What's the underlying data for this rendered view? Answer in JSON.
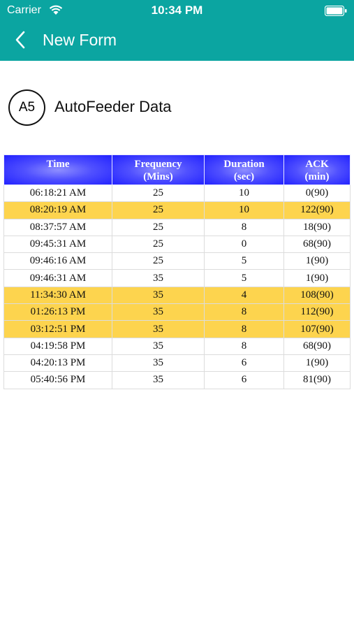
{
  "status": {
    "carrier": "Carrier",
    "time": "10:34 PM"
  },
  "nav": {
    "title": "New Form"
  },
  "section": {
    "badge": "A5",
    "title": "AutoFeeder Data"
  },
  "table": {
    "headers": [
      {
        "line1": "Time",
        "line2": ""
      },
      {
        "line1": "Frequency",
        "line2": "(Mins)"
      },
      {
        "line1": "Duration",
        "line2": "(sec)"
      },
      {
        "line1": "ACK",
        "line2": "(min)"
      }
    ],
    "rows": [
      {
        "time": "06:18:21 AM",
        "frequency": "25",
        "duration": "10",
        "ack": "0(90)",
        "highlight": false
      },
      {
        "time": "08:20:19 AM",
        "frequency": "25",
        "duration": "10",
        "ack": "122(90)",
        "highlight": true
      },
      {
        "time": "08:37:57 AM",
        "frequency": "25",
        "duration": "8",
        "ack": "18(90)",
        "highlight": false
      },
      {
        "time": "09:45:31 AM",
        "frequency": "25",
        "duration": "0",
        "ack": "68(90)",
        "highlight": false
      },
      {
        "time": "09:46:16 AM",
        "frequency": "25",
        "duration": "5",
        "ack": "1(90)",
        "highlight": false
      },
      {
        "time": "09:46:31 AM",
        "frequency": "35",
        "duration": "5",
        "ack": "1(90)",
        "highlight": false
      },
      {
        "time": "11:34:30 AM",
        "frequency": "35",
        "duration": "4",
        "ack": "108(90)",
        "highlight": true
      },
      {
        "time": "01:26:13 PM",
        "frequency": "35",
        "duration": "8",
        "ack": "112(90)",
        "highlight": true
      },
      {
        "time": "03:12:51 PM",
        "frequency": "35",
        "duration": "8",
        "ack": "107(90)",
        "highlight": true
      },
      {
        "time": "04:19:58 PM",
        "frequency": "35",
        "duration": "8",
        "ack": "68(90)",
        "highlight": false
      },
      {
        "time": "04:20:13 PM",
        "frequency": "35",
        "duration": "6",
        "ack": "1(90)",
        "highlight": false
      },
      {
        "time": "05:40:56 PM",
        "frequency": "35",
        "duration": "6",
        "ack": "81(90)",
        "highlight": false
      }
    ]
  },
  "colors": {
    "header_teal": "#0ba5a1",
    "table_header_blue": "#2222ff",
    "row_highlight": "#fdd44e"
  },
  "icons": {
    "back": "chevron-left-icon",
    "wifi": "wifi-icon",
    "battery": "battery-icon"
  }
}
